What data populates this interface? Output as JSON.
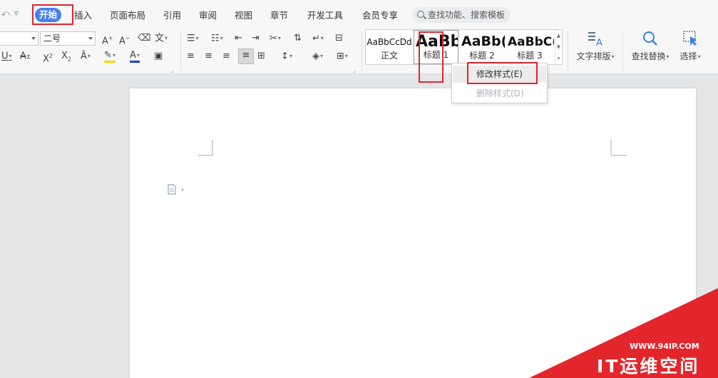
{
  "menubar": {
    "quick_access": [
      "⤺",
      "▿"
    ],
    "tabs": [
      "开始",
      "插入",
      "页面布局",
      "引用",
      "审阅",
      "视图",
      "章节",
      "开发工具",
      "会员专享"
    ],
    "active_tab": "开始",
    "search_placeholder": "查找功能、搜索模板"
  },
  "ribbon": {
    "font_size": "二号",
    "style_gallery": [
      {
        "preview": "AaBbCcDd",
        "name": "正文"
      },
      {
        "preview": "AaBb",
        "name": "标题 1"
      },
      {
        "preview": "AaBb(",
        "name": "标题 2"
      },
      {
        "preview": "AaBbC(",
        "name": "标题 3"
      }
    ],
    "text_layout_label": "文字排版",
    "find_replace_label": "查找替换",
    "select_label": "选择"
  },
  "context_menu": {
    "items": [
      {
        "label": "修改样式(E)",
        "enabled": true
      },
      {
        "label": "删除样式(D)",
        "enabled": false
      }
    ]
  },
  "watermark": {
    "url": "WWW.94IP.COM",
    "name": "IT运维空间"
  },
  "colors": {
    "accent": "#4a7ff0",
    "highlight_red": "#e0252b",
    "watermark_red": "#e3262c"
  }
}
